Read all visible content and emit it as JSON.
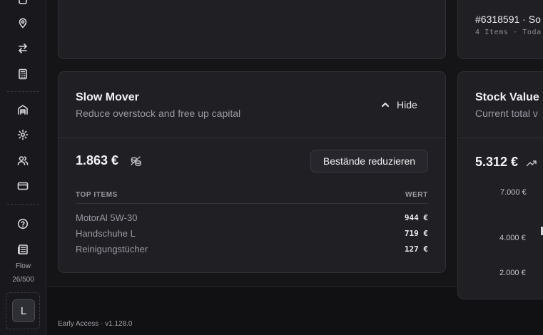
{
  "sidebar": {
    "icons": [
      "box-icon",
      "map-pin-icon",
      "transfer-icon",
      "calculator-icon",
      "warehouse-icon",
      "gear-icon",
      "users-icon",
      "credit-card-icon",
      "help-icon",
      "newspaper-icon"
    ],
    "flow_label": "Flow",
    "flow_count": "26/500",
    "avatar_initial": "L"
  },
  "top_right_card": {
    "order_title": "#6318591 · So",
    "order_sub": "4 Items · Toda"
  },
  "slow_mover": {
    "title": "Slow Mover",
    "subtitle": "Reduce overstock and free up capital",
    "hide_label": "Hide",
    "value": "1.863 €",
    "action_label": "Bestände reduzieren",
    "col_items": "TOP ITEMS",
    "col_value": "WERT",
    "rows": [
      {
        "name": "MotorAl 5W-30",
        "value": "944 €"
      },
      {
        "name": "Handschuhe L",
        "value": "719 €"
      },
      {
        "name": "Reinigungstücher",
        "value": "127 €"
      }
    ]
  },
  "stock_value": {
    "title": "Stock Value",
    "subtitle": "Current total v",
    "value": "5.312 €",
    "trend_icon": "trending-up-icon",
    "ticks": [
      "7.000 €",
      "4.000 €",
      "2.000 €"
    ]
  },
  "footer": {
    "version": "Early Access · v1.128.0"
  },
  "colors": {
    "background": "#151518",
    "card": "#1f1f24",
    "border": "#2f2f36",
    "text_primary": "#f2f2f5",
    "text_muted": "#9a9aa3"
  }
}
